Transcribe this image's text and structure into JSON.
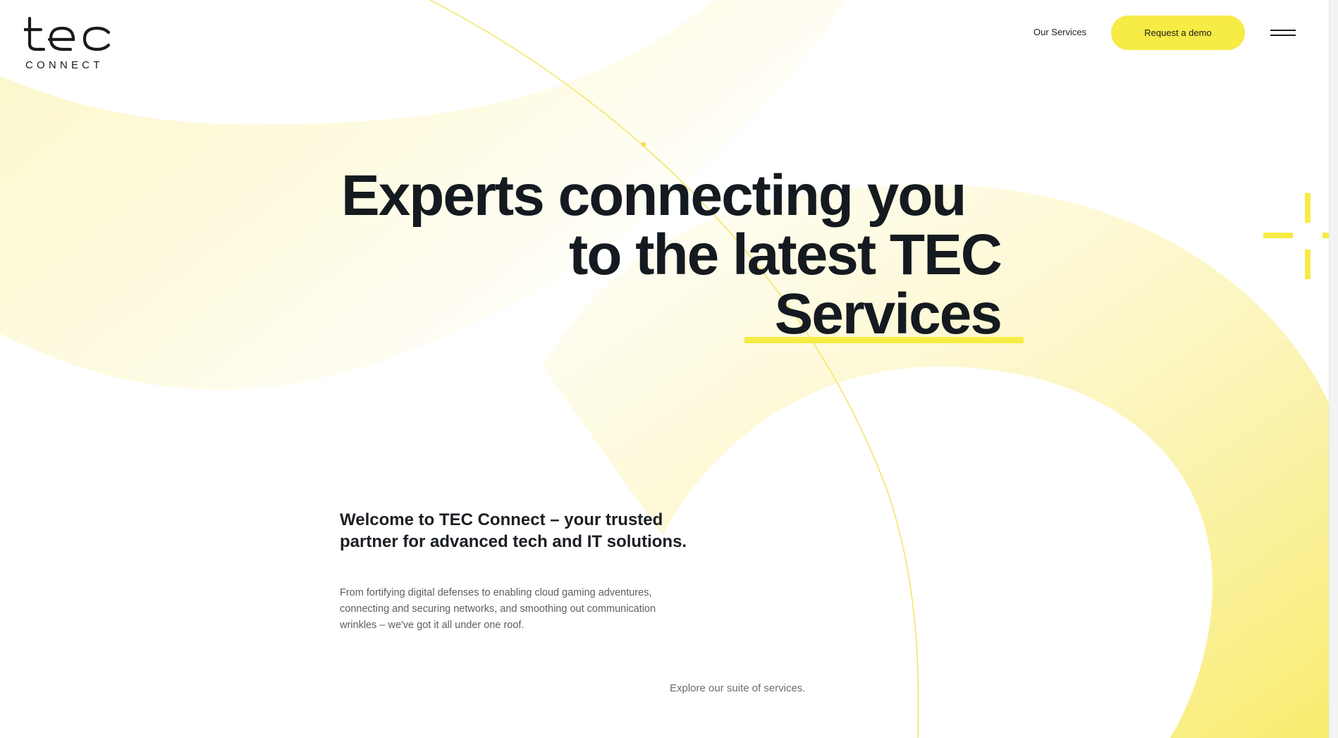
{
  "brand": {
    "logo_main": "tec",
    "logo_sub": "CONNECT",
    "accent": "#f7eb46"
  },
  "header": {
    "nav_link": "Our Services",
    "cta_label": "Request a demo",
    "menu_icon": "hamburger-icon"
  },
  "hero": {
    "line1": "Experts connecting you",
    "line2": "to the latest TEC",
    "line3": "Services"
  },
  "intro": {
    "heading": "Welcome to TEC Connect – your trusted partner for advanced tech and IT solutions.",
    "body": "From fortifying digital defenses to enabling cloud gaming adventures, connecting and securing networks, and smoothing out communication wrinkles – we've got it all under one roof."
  },
  "explore": {
    "label": "Explore our suite of services."
  },
  "decor": {
    "crosshair_icon": "crosshair-icon"
  }
}
